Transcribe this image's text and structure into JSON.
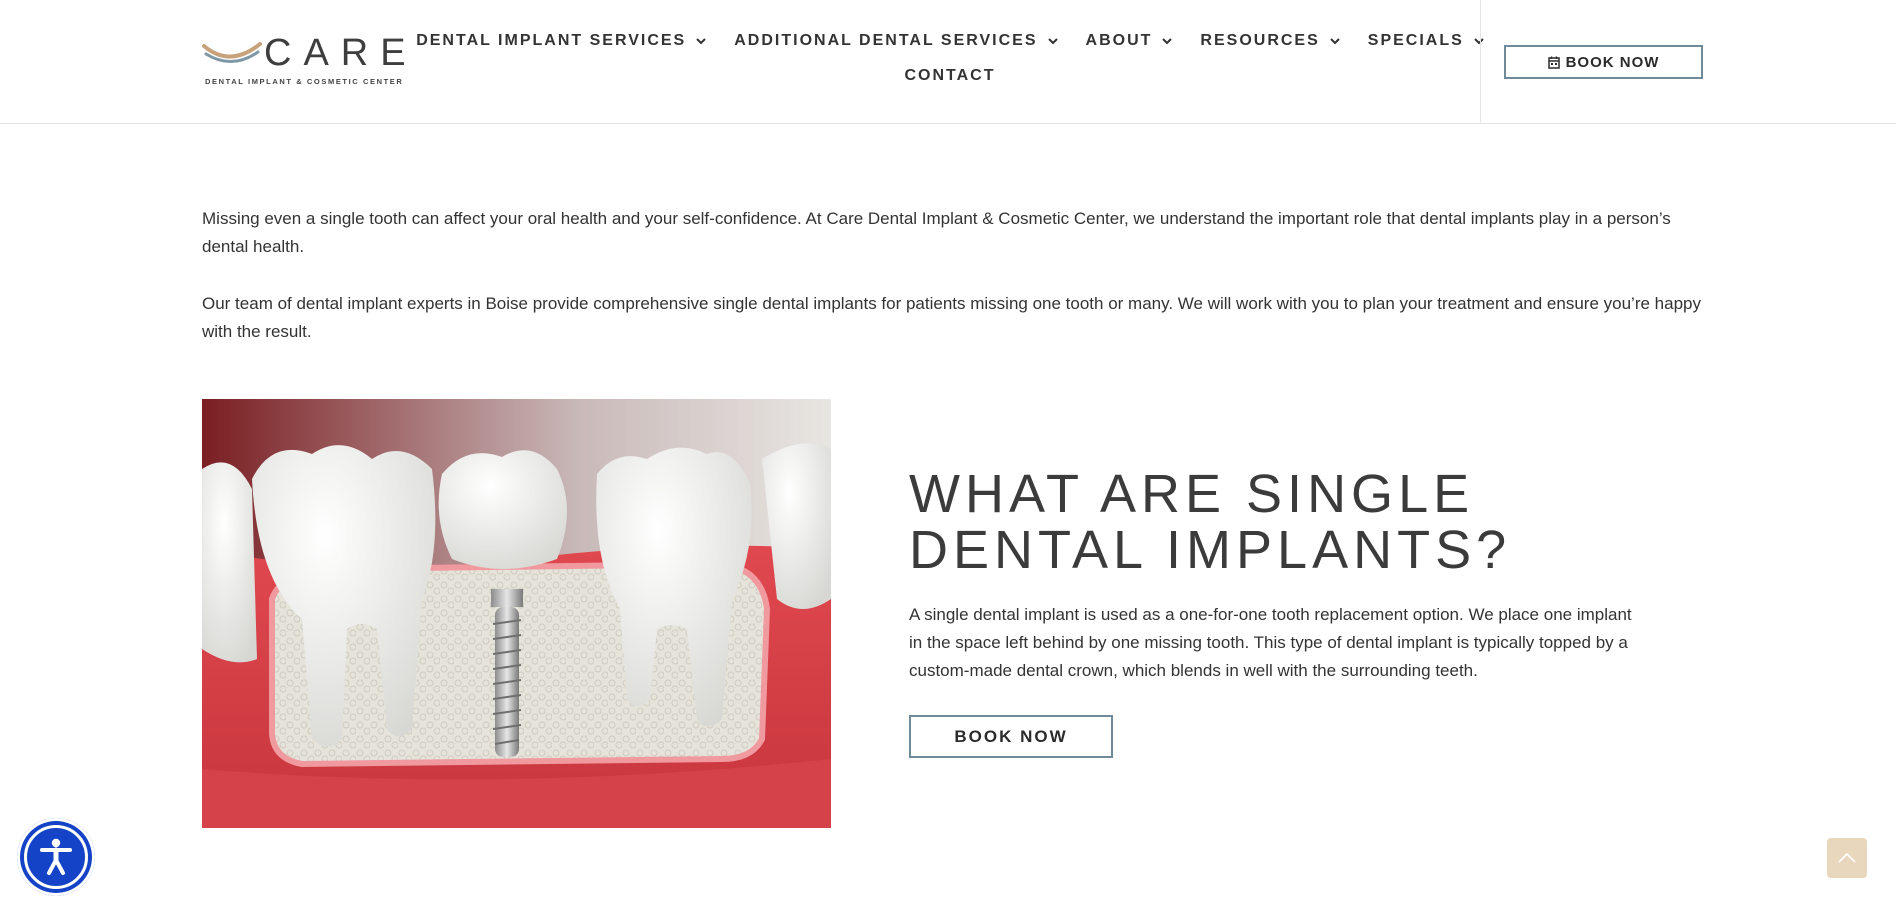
{
  "brand": {
    "name": "CARE",
    "tagline": "DENTAL IMPLANT & COSMETIC CENTER"
  },
  "nav": {
    "items": [
      {
        "label": "DENTAL IMPLANT SERVICES",
        "icon": "chevron-down-icon"
      },
      {
        "label": "ADDITIONAL DENTAL SERVICES",
        "icon": "chevron-down-icon"
      },
      {
        "label": "ABOUT",
        "icon": "chevron-down-icon"
      },
      {
        "label": "RESOURCES",
        "icon": "chevron-down-icon"
      },
      {
        "label": "SPECIALS",
        "icon": "chevron-down-icon"
      }
    ],
    "contact": "CONTACT",
    "book_now": "BOOK NOW"
  },
  "intro": {
    "p1": "Missing even a single tooth can affect your oral health and your self-confidence. At Care Dental Implant & Cosmetic Center, we understand the important role that dental implants play in a person’s dental health.",
    "p2": "Our team of dental implant experts in Boise provide comprehensive single dental implants for patients missing one tooth or many. We will work with you to plan your treatment and ensure you’re happy with the result."
  },
  "section": {
    "heading": "WHAT ARE SINGLE DENTAL IMPLANTS?",
    "body": "A single dental implant is used as a one-for-one tooth replacement option. We place one implant in the space left behind by one missing tooth. This type of dental implant is typically topped by a custom-made dental crown, which blends in well with the surrounding teeth.",
    "button": "BOOK NOW"
  },
  "colors": {
    "accent_border": "#6f8a99",
    "accessibility_blue": "#1443c7",
    "to_top_bg": "#e8d6bd",
    "gum_red": "#d9444b"
  }
}
